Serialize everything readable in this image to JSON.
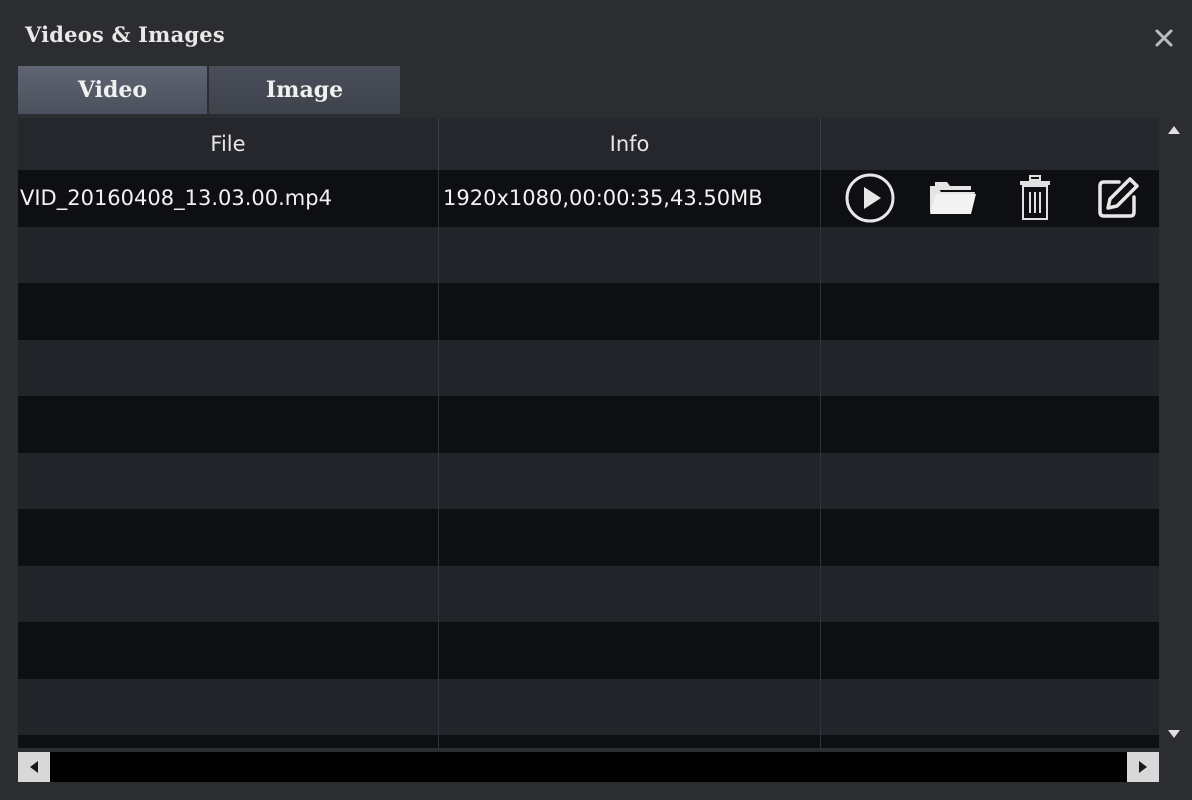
{
  "window": {
    "title": "Videos & Images"
  },
  "tabs": [
    {
      "label": "Video",
      "active": true
    },
    {
      "label": "Image",
      "active": false
    }
  ],
  "table": {
    "columns": [
      "File",
      "Info",
      ""
    ],
    "rows": [
      {
        "file": "VID_20160408_13.03.00.mp4",
        "info": "1920x1080,00:00:35,43.50MB",
        "actions": [
          "play-icon",
          "folder-icon",
          "trash-icon",
          "edit-icon"
        ]
      },
      {
        "file": "",
        "info": ""
      },
      {
        "file": "",
        "info": ""
      },
      {
        "file": "",
        "info": ""
      },
      {
        "file": "",
        "info": ""
      },
      {
        "file": "",
        "info": ""
      },
      {
        "file": "",
        "info": ""
      },
      {
        "file": "",
        "info": ""
      },
      {
        "file": "",
        "info": ""
      },
      {
        "file": "",
        "info": ""
      },
      {
        "file": "",
        "info": ""
      }
    ]
  },
  "colors": {
    "background": "#2b2d31",
    "row_dark": "#0e0f12",
    "row_light": "#22242a",
    "tab_active": "#5a606d",
    "text": "#f2f2f2"
  }
}
